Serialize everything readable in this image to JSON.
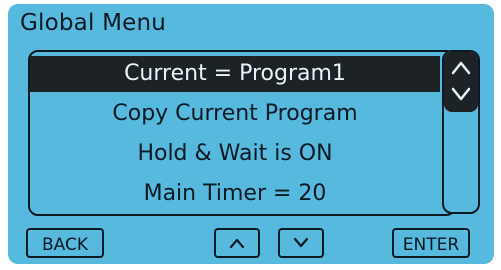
{
  "header": {
    "title": "Global Menu"
  },
  "menu": {
    "items": [
      {
        "label": "Current = Program1",
        "selected": true
      },
      {
        "label": "Copy Current Program",
        "selected": false
      },
      {
        "label": "Hold & Wait is ON",
        "selected": false
      },
      {
        "label": "Main Timer = 20",
        "selected": false
      }
    ]
  },
  "buttons": {
    "back_label": "BACK",
    "enter_label": "ENTER"
  },
  "icons": {
    "up": "chevron-up-icon",
    "down": "chevron-down-icon",
    "scroll": "scroll-up-down-icon"
  },
  "colors": {
    "screen_background": "#56b9dd",
    "selected_background": "#1c2226",
    "selected_text": "#e8f4f8",
    "text": "#0a1a22"
  }
}
